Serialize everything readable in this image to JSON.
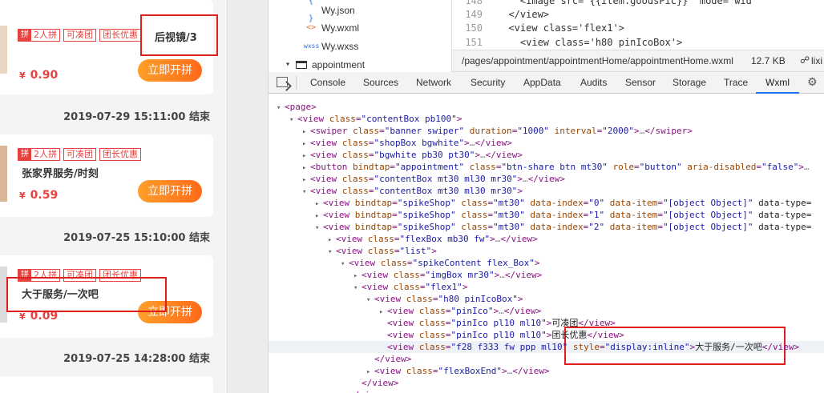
{
  "simulator": {
    "cards": [
      {
        "tags": [
          "2人拼",
          "可凑团",
          "团长优惠"
        ],
        "title": "后视镜/3",
        "price": "0.90",
        "button_label": "立即开拼",
        "end_time": "2019-07-29 15:11:00 结束"
      },
      {
        "tags": [
          "2人拼",
          "可凑团",
          "团长优惠"
        ],
        "title": "张家界服务/时刻",
        "price": "0.59",
        "button_label": "立即开拼",
        "end_time": "2019-07-25 15:10:00 结束"
      },
      {
        "tags": [
          "2人拼",
          "可凑团",
          "团长优惠"
        ],
        "title": "大于服务/一次吧",
        "price": "0.09",
        "button_label": "立即开拼",
        "end_time": "2019-07-25 14:28:00 结束"
      }
    ],
    "currency_symbol": "¥",
    "people_icon": "拼"
  },
  "file_tree": {
    "items": [
      {
        "icon": "{ }",
        "icon_name": "json-file-icon",
        "name": "Wy.json",
        "color": "#1a73e8"
      },
      {
        "icon": "<>",
        "icon_name": "wxml-file-icon",
        "name": "Wy.wxml",
        "color": "#e8752b"
      },
      {
        "icon": "wxss",
        "icon_name": "wxss-file-icon",
        "name": "Wy.wxss",
        "color": "#2b6ce8"
      },
      {
        "icon": "▾",
        "icon_name": "folder-icon",
        "name": "appointment",
        "color": "#333333"
      }
    ]
  },
  "editor": {
    "lines": [
      {
        "num": "148",
        "text": "    <image src=\"{{item.goodsPic}}\" mode=\"wid"
      },
      {
        "num": "149",
        "text": "  </view>"
      },
      {
        "num": "150",
        "text": "  <view class='flex1'>"
      },
      {
        "num": "151",
        "text": "    <view class='h80 pinIcoBox'>"
      }
    ],
    "status_path": "/pages/appointment/appointmentHome/appointmentHome.wxml",
    "status_size": "12.7 KB",
    "status_branch": "lixi"
  },
  "devtools": {
    "tabs": [
      "Console",
      "Sources",
      "Network",
      "Security",
      "AppData",
      "Audits",
      "Sensor",
      "Storage",
      "Trace",
      "Wxml"
    ],
    "active_tab": "Wxml",
    "tree": [
      {
        "d": 0,
        "tw": "▾",
        "t": "<page>"
      },
      {
        "d": 1,
        "tw": "▾",
        "t": "<view class=\"contentBox pb100\">"
      },
      {
        "d": 2,
        "tw": "▸",
        "t": "<swiper class=\"banner swiper\" duration=\"1000\" interval=\"2000\">…</swiper>"
      },
      {
        "d": 2,
        "tw": "▸",
        "t": "<view class=\"shopBox bgwhite\">…</view>"
      },
      {
        "d": 2,
        "tw": "▸",
        "t": "<view class=\"bgwhite pb30 pt30\">…</view>"
      },
      {
        "d": 2,
        "tw": "▸",
        "t": "<button bindtap=\"appointment\" class=\"btn-share btn mt30\" role=\"button\" aria-disabled=\"false\">…"
      },
      {
        "d": 2,
        "tw": "▸",
        "t": "<view class=\"contentBox mt30 ml30 mr30\">…</view>"
      },
      {
        "d": 2,
        "tw": "▾",
        "t": "<view class=\"contentBox mt30 ml30 mr30\">"
      },
      {
        "d": 3,
        "tw": "▸",
        "t": "<view bindtap=\"spikeShop\" class=\"mt30\" data-index=\"0\" data-item=\"[object Object]\" data-type="
      },
      {
        "d": 3,
        "tw": "▸",
        "t": "<view bindtap=\"spikeShop\" class=\"mt30\" data-index=\"1\" data-item=\"[object Object]\" data-type="
      },
      {
        "d": 3,
        "tw": "▾",
        "t": "<view bindtap=\"spikeShop\" class=\"mt30\" data-index=\"2\" data-item=\"[object Object]\" data-type="
      },
      {
        "d": 4,
        "tw": "▸",
        "t": "<view class=\"flexBox mb30 fw\">…</view>"
      },
      {
        "d": 4,
        "tw": "▾",
        "t": "<view class=\"list\">"
      },
      {
        "d": 5,
        "tw": "▾",
        "t": "<view class=\"spikeContent flex_Box\">"
      },
      {
        "d": 6,
        "tw": "▸",
        "t": "<view class=\"imgBox mr30\">…</view>"
      },
      {
        "d": 6,
        "tw": "▾",
        "t": "<view class=\"flex1\">"
      },
      {
        "d": 7,
        "tw": "▾",
        "t": "<view class=\"h80 pinIcoBox\">"
      },
      {
        "d": 8,
        "tw": "▸",
        "t": "<view class=\"pinIco\">…</view>"
      },
      {
        "d": 8,
        "tw": "",
        "t": "<view class=\"pinIco pl10 ml10\">可凑团</view>"
      },
      {
        "d": 8,
        "tw": "",
        "t": "<view class=\"pinIco pl10 ml10\">团长优惠</view>"
      },
      {
        "d": 8,
        "tw": "",
        "t": "<view class=\"f28 f333 fw ppp ml10\" style=\"display:inline\">大于服务/一次吧</view>"
      },
      {
        "d": 7,
        "tw": "",
        "t": "</view>"
      },
      {
        "d": 7,
        "tw": "▸",
        "t": "<view class=\"flexBoxEnd\">…</view>"
      },
      {
        "d": 6,
        "tw": "",
        "t": "</view>"
      },
      {
        "d": 5,
        "tw": "",
        "t": "</view>"
      }
    ]
  }
}
